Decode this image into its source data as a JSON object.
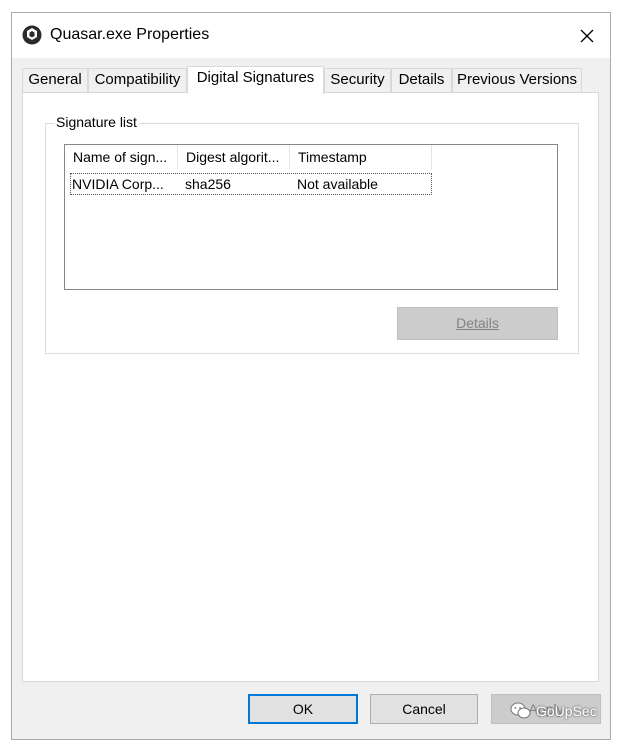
{
  "window": {
    "title": "Quasar.exe Properties",
    "icon": "quasar-app-icon",
    "close_glyph": "✕"
  },
  "tabs": [
    {
      "label": "General",
      "selected": false
    },
    {
      "label": "Compatibility",
      "selected": false
    },
    {
      "label": "Digital Signatures",
      "selected": true
    },
    {
      "label": "Security",
      "selected": false
    },
    {
      "label": "Details",
      "selected": false
    },
    {
      "label": "Previous Versions",
      "selected": false
    }
  ],
  "signature_list": {
    "group_label": "Signature list",
    "columns": [
      "Name of sign...",
      "Digest algorit...",
      "Timestamp"
    ],
    "rows": [
      [
        "NVIDIA Corp...",
        "sha256",
        "Not available"
      ]
    ],
    "details_button": {
      "label": "Details",
      "enabled": false
    }
  },
  "dialog_buttons": {
    "ok": "OK",
    "cancel": "Cancel",
    "apply": "Apply"
  },
  "watermark": {
    "text": "GoUpSec",
    "icon": "wechat-icon"
  },
  "colors": {
    "focus_border": "#0078d7",
    "disabled_text": "#838383"
  }
}
